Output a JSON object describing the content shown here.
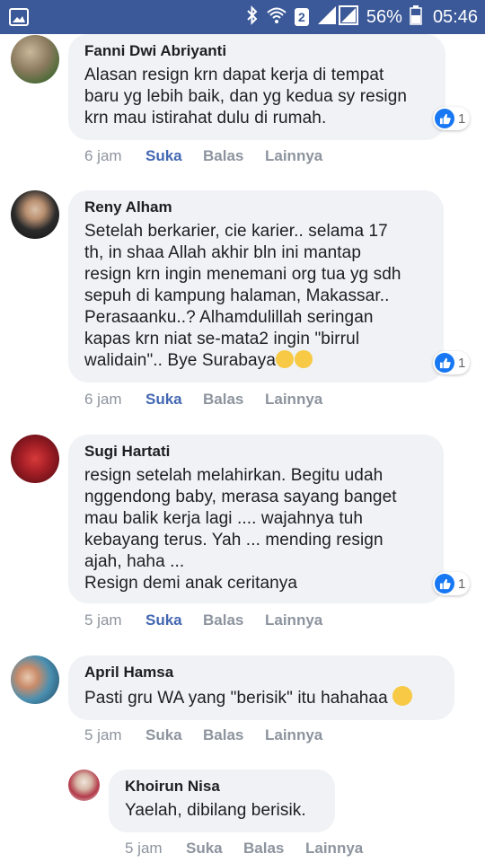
{
  "status_bar": {
    "sim_badge": "2",
    "battery_percent": "56%",
    "time": "05:46",
    "bg_color": "#3b5998",
    "icons": [
      "gallery-icon",
      "bluetooth-icon",
      "wifi-icon",
      "signal-icon",
      "battery-icon"
    ]
  },
  "comments": [
    {
      "author": "Fanni Dwi Abriyanti",
      "text": "Alasan resign krn dapat kerja di tempat\nbaru yg lebih baik, dan yg kedua sy resign\nkrn mau istirahat dulu di rumah.",
      "reactions": "1",
      "time": "6 jam",
      "like": "Suka",
      "reply": "Balas",
      "more": "Lainnya",
      "liked": true
    },
    {
      "author": "Reny Alham",
      "text": "Setelah berkarier, cie karier.. selama 17\nth, in shaa Allah akhir bln ini mantap\nresign krn ingin menemani org tua yg sdh\nsepuh di kampung halaman, Makassar..\nPerasaanku..? Alhamdulillah seringan\nkapas krn niat se-mata2 ingin \"birrul\nwalidain\".. Bye Surabaya",
      "reactions": "1",
      "time": "6 jam",
      "like": "Suka",
      "reply": "Balas",
      "more": "Lainnya",
      "liked": true
    },
    {
      "author": "Sugi Hartati",
      "text": "resign setelah melahirkan. Begitu udah\nnggendong baby, merasa sayang banget\nmau balik kerja lagi .... wajahnya tuh\nkebayang terus. Yah ... mending resign\najah, haha ...\nResign demi anak ceritanya",
      "reactions": "1",
      "time": "5 jam",
      "like": "Suka",
      "reply": "Balas",
      "more": "Lainnya",
      "liked": true
    },
    {
      "author": "April Hamsa",
      "text": "Pasti gru WA yang \"berisik\" itu hahahaa",
      "time": "5 jam",
      "like": "Suka",
      "reply": "Balas",
      "more": "Lainnya",
      "liked": false
    },
    {
      "author": "Khoirun Nisa",
      "text": "Yaelah, dibilang berisik.",
      "time": "5 jam",
      "like": "Suka",
      "reply": "Balas",
      "more": "Lainnya",
      "liked": false
    }
  ]
}
